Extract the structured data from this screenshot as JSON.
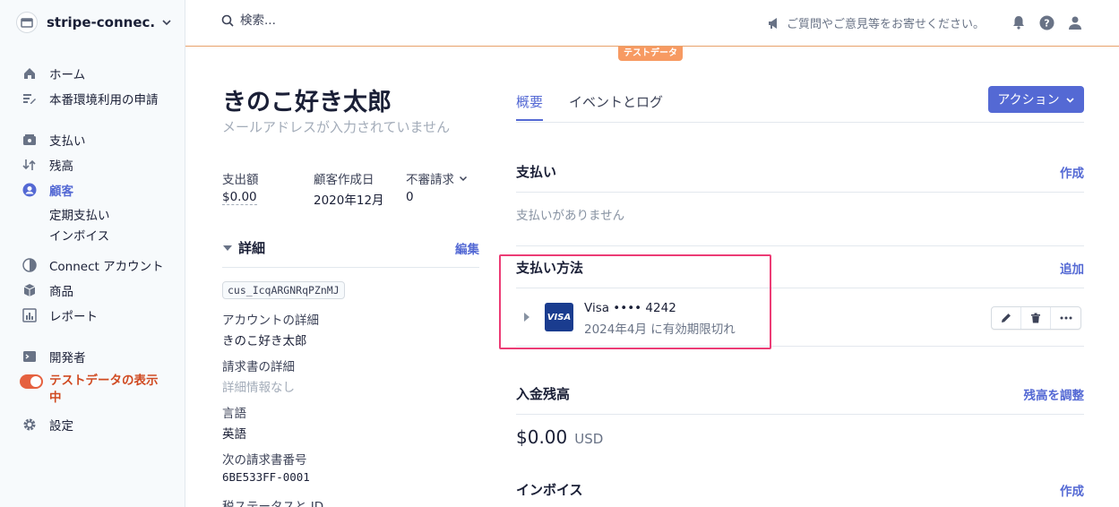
{
  "sidebar": {
    "account_name": "stripe-connec...",
    "items": [
      {
        "label": "ホーム"
      },
      {
        "label": "本番環境利用の申請"
      },
      {
        "label": "支払い"
      },
      {
        "label": "残高"
      },
      {
        "label": "顧客"
      },
      {
        "label": "定期支払い"
      },
      {
        "label": "インボイス"
      },
      {
        "label": "Connect アカウント"
      },
      {
        "label": "商品"
      },
      {
        "label": "レポート"
      },
      {
        "label": "開発者"
      },
      {
        "label": "テストデータの表示中"
      },
      {
        "label": "設定"
      }
    ]
  },
  "header": {
    "search_placeholder": "検索...",
    "feedback": "ご質問やご意見等をお寄せください。",
    "test_badge": "テストデータ"
  },
  "customer": {
    "name": "きのこ好き太郎",
    "email_missing": "メールアドレスが入力されていません",
    "stats": [
      {
        "label": "支出額",
        "value": "$0.00"
      },
      {
        "label": "顧客作成日",
        "value": "2020年12月"
      },
      {
        "label": "不審請求",
        "value": "0"
      }
    ],
    "details_title": "詳細",
    "edit_label": "編集",
    "id": "cus_IcqARGNRqPZnMJ",
    "fields": [
      {
        "key": "アカウントの詳細",
        "value": "きのこ好き太郎"
      },
      {
        "key": "請求書の詳細",
        "value": "詳細情報なし"
      },
      {
        "key": "言語",
        "value": "英語"
      },
      {
        "key": "次の請求書番号",
        "value": "6BE533FF-0001"
      },
      {
        "key": "税ステータスと ID",
        "value": ""
      }
    ]
  },
  "main": {
    "tabs": [
      {
        "label": "概要"
      },
      {
        "label": "イベントとログ"
      }
    ],
    "action_label": "アクション",
    "payments": {
      "title": "支払い",
      "link": "作成",
      "empty": "支払いがありません"
    },
    "payment_methods": {
      "title": "支払い方法",
      "link": "追加",
      "brand": "VISA",
      "card": "Visa •••• 4242",
      "expiry": "2024年4月 に有効期限切れ"
    },
    "balance": {
      "title": "入金残高",
      "link": "残高を調整",
      "amount": "$0.00",
      "currency": "USD"
    },
    "invoices": {
      "title": "インボイス",
      "link": "作成"
    }
  },
  "colors": {
    "accent": "#5469d4",
    "test_mode": "#e5613f",
    "highlight": "#ec3c75"
  }
}
